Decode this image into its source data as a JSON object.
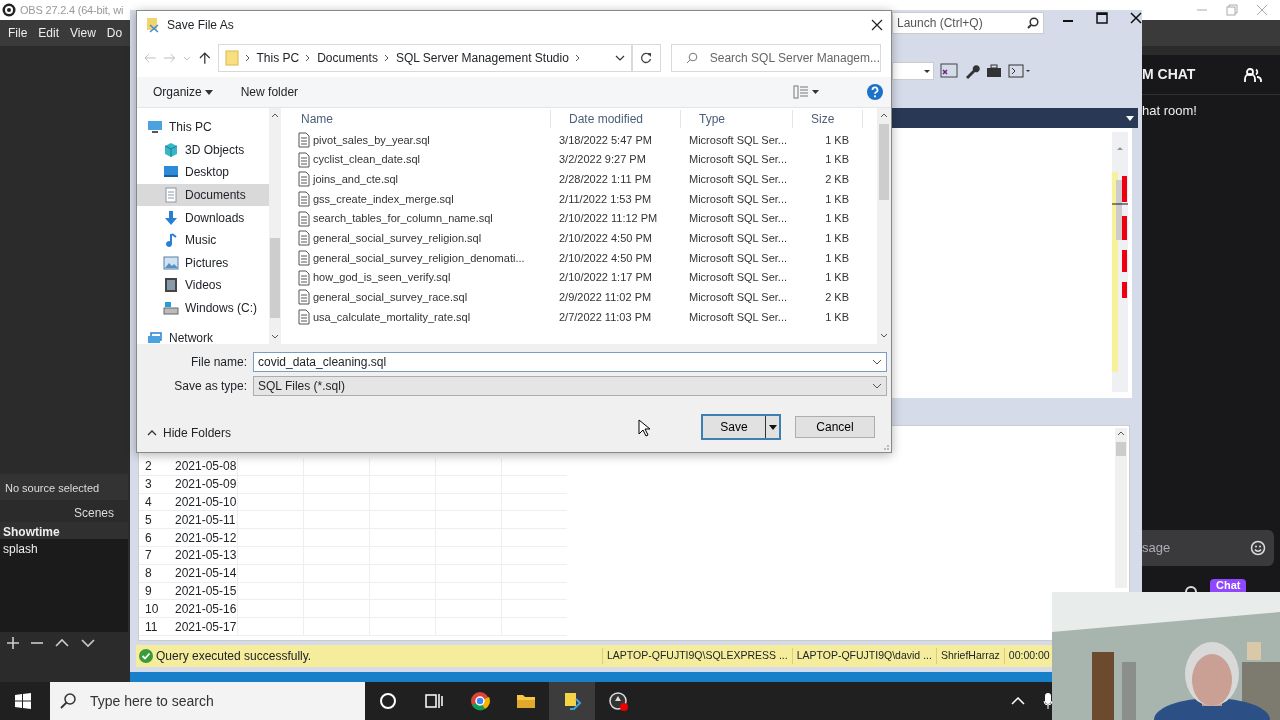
{
  "obs": {
    "title": "OBS 27.2.4 (64-bit, wi",
    "menu": [
      "File",
      "Edit",
      "View",
      "Do"
    ],
    "source_label": "No source selected",
    "scenes_title": "Scenes",
    "scenes": [
      {
        "name": "Showtime",
        "selected": true
      },
      {
        "name": "splash",
        "selected": false
      }
    ]
  },
  "ssms": {
    "quick_launch": "Launch (Ctrl+Q)",
    "rows": [
      {
        "num": "2",
        "date": "2021-05-08"
      },
      {
        "num": "3",
        "date": "2021-05-09"
      },
      {
        "num": "4",
        "date": "2021-05-10"
      },
      {
        "num": "5",
        "date": "2021-05-11"
      },
      {
        "num": "6",
        "date": "2021-05-12"
      },
      {
        "num": "7",
        "date": "2021-05-13"
      },
      {
        "num": "8",
        "date": "2021-05-14"
      },
      {
        "num": "9",
        "date": "2021-05-15"
      },
      {
        "num": "10",
        "date": "2021-05-16"
      },
      {
        "num": "11",
        "date": "2021-05-17"
      }
    ],
    "status_bar": {
      "message": "Query executed successfully.",
      "server": "LAPTOP-QFUJTI9Q\\SQLEXPRESS ...",
      "user": "LAPTOP-QFUJTI9Q\\david ...",
      "database": "ShriefHarraz",
      "elapsed": "00:00:00"
    }
  },
  "chat": {
    "title": "M CHAT",
    "welcome": "hat room!",
    "placeholder": "sage",
    "send_button": "Chat"
  },
  "dialog": {
    "title": "Save File As",
    "breadcrumb": [
      "This PC",
      "Documents",
      "SQL Server Management Studio"
    ],
    "search_placeholder": "Search SQL Server Managem...",
    "toolbar": [
      "Organize",
      "New folder"
    ],
    "nav": [
      {
        "label": "This PC",
        "kind": "pc",
        "selected": false,
        "children": [
          {
            "label": "3D Objects",
            "kind": "cube",
            "selected": false
          },
          {
            "label": "Desktop",
            "kind": "desktop",
            "selected": false
          },
          {
            "label": "Documents",
            "kind": "documents",
            "selected": true
          },
          {
            "label": "Downloads",
            "kind": "downloads",
            "selected": false
          },
          {
            "label": "Music",
            "kind": "music",
            "selected": false
          },
          {
            "label": "Pictures",
            "kind": "pictures",
            "selected": false
          },
          {
            "label": "Videos",
            "kind": "videos",
            "selected": false
          },
          {
            "label": "Windows (C:)",
            "kind": "drive",
            "selected": false
          }
        ]
      },
      {
        "label": "Network",
        "kind": "network",
        "selected": false
      }
    ],
    "columns": [
      "Name",
      "Date modified",
      "Type",
      "Size"
    ],
    "files": [
      {
        "name": "pivot_sales_by_year.sql",
        "date": "3/18/2022 5:47 PM",
        "type": "Microsoft SQL Ser...",
        "size": "1 KB"
      },
      {
        "name": "cyclist_clean_date.sql",
        "date": "3/2/2022 9:27 PM",
        "type": "Microsoft SQL Ser...",
        "size": "1 KB"
      },
      {
        "name": "joins_and_cte.sql",
        "date": "2/28/2022 1:11 PM",
        "type": "Microsoft SQL Ser...",
        "size": "2 KB"
      },
      {
        "name": "gss_create_index_merge.sql",
        "date": "2/11/2022 1:53 PM",
        "type": "Microsoft SQL Ser...",
        "size": "1 KB"
      },
      {
        "name": "search_tables_for_column_name.sql",
        "date": "2/10/2022 11:12 PM",
        "type": "Microsoft SQL Ser...",
        "size": "1 KB"
      },
      {
        "name": "general_social_survey_religion.sql",
        "date": "2/10/2022 4:50 PM",
        "type": "Microsoft SQL Ser...",
        "size": "1 KB"
      },
      {
        "name": "general_social_survey_religion_denomati...",
        "date": "2/10/2022 4:50 PM",
        "type": "Microsoft SQL Ser...",
        "size": "1 KB"
      },
      {
        "name": "how_god_is_seen_verify.sql",
        "date": "2/10/2022 1:17 PM",
        "type": "Microsoft SQL Ser...",
        "size": "1 KB"
      },
      {
        "name": "general_social_survey_race.sql",
        "date": "2/9/2022 11:02 PM",
        "type": "Microsoft SQL Ser...",
        "size": "2 KB"
      },
      {
        "name": "usa_calculate_mortality_rate.sql",
        "date": "2/7/2022 11:03 PM",
        "type": "Microsoft SQL Ser...",
        "size": "1 KB"
      }
    ],
    "file_name_label": "File name:",
    "file_name": "covid_data_cleaning.sql",
    "type_label": "Save as type:",
    "save_type": "SQL Files (*.sql)",
    "hide_folders": "Hide Folders",
    "save_button": "Save",
    "cancel_button": "Cancel"
  },
  "taskbar": {
    "search_placeholder": "Type here to search"
  }
}
